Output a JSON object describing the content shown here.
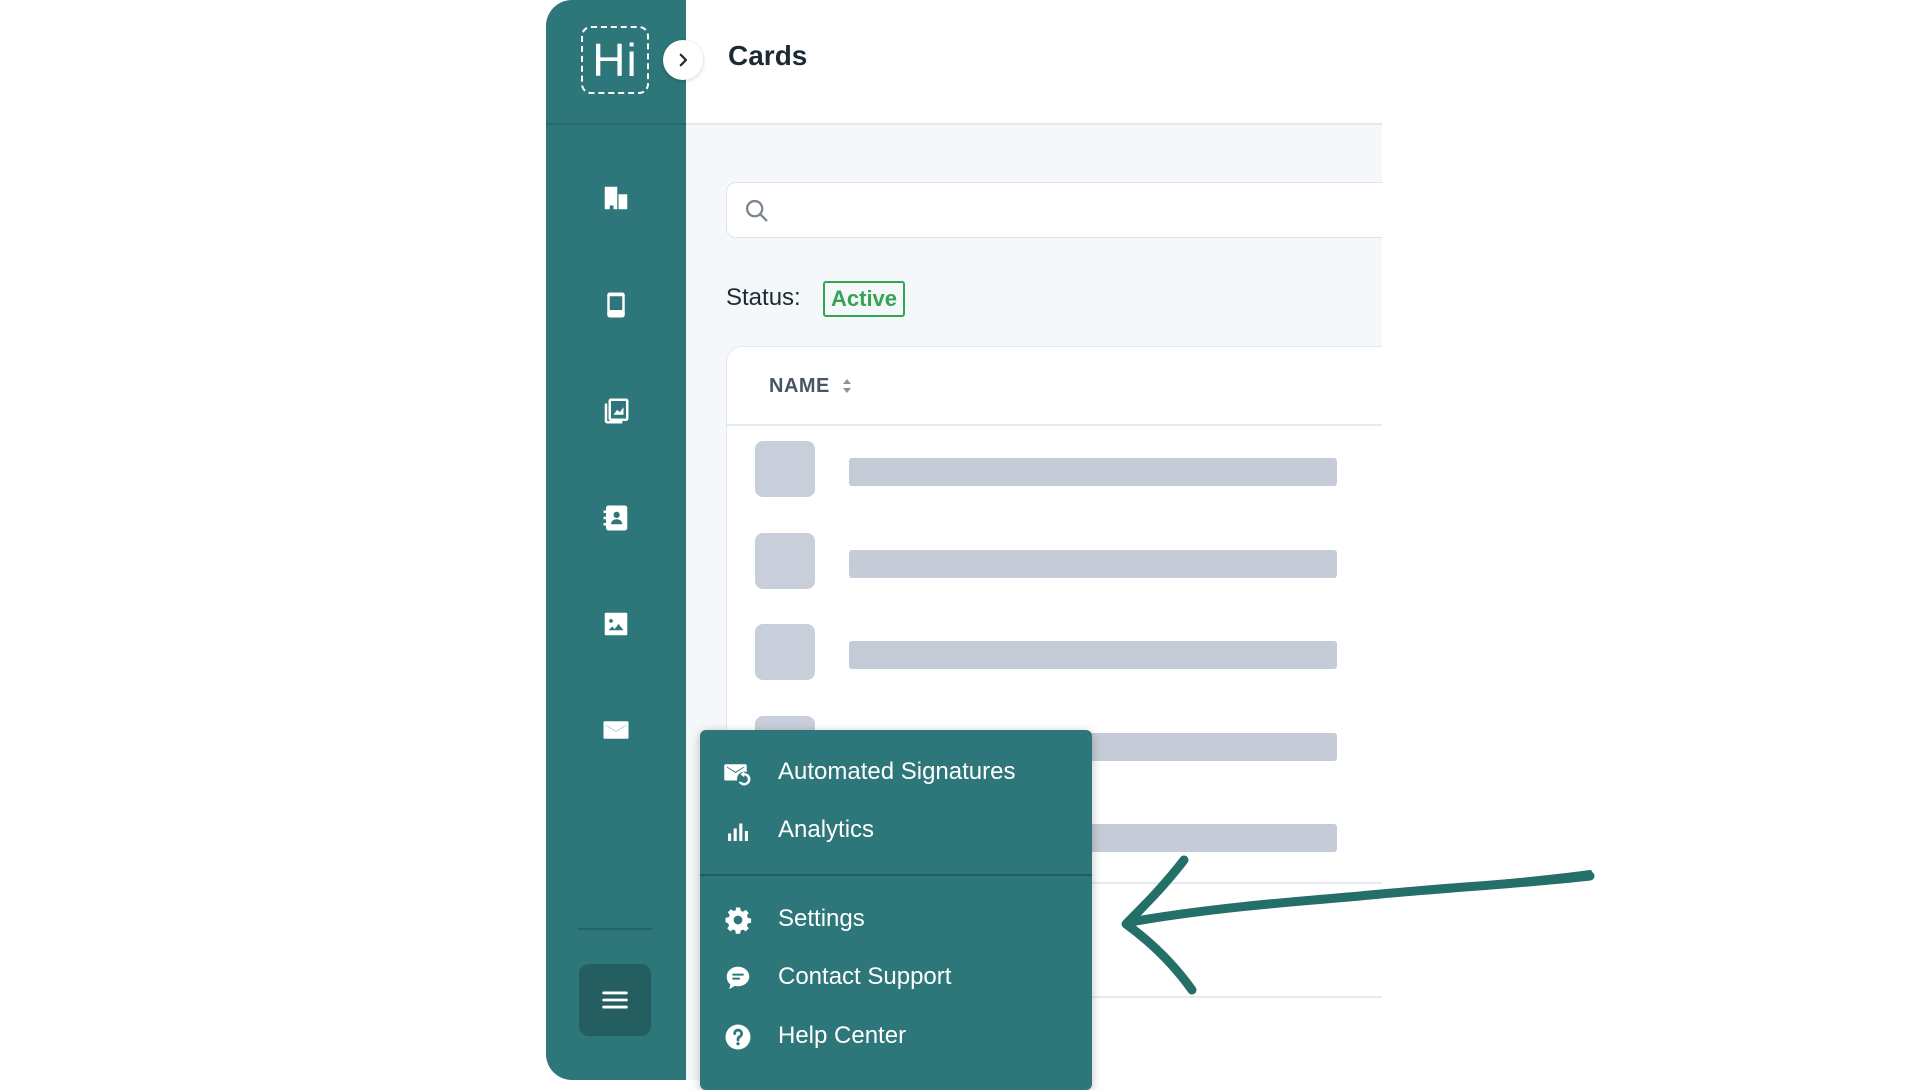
{
  "app": {
    "logo_text": "Hi",
    "page_title": "Cards"
  },
  "sidebar": {
    "items": [
      {
        "name": "company",
        "icon": "building-icon"
      },
      {
        "name": "cards",
        "icon": "phone-card-icon"
      },
      {
        "name": "templates",
        "icon": "card-stack-icon"
      },
      {
        "name": "contacts",
        "icon": "contact-book-icon"
      },
      {
        "name": "backgrounds",
        "icon": "image-icon"
      },
      {
        "name": "email-signatures",
        "icon": "envelope-icon"
      }
    ],
    "menu_icon": "hamburger-icon",
    "expand_icon": "chevron-right-icon"
  },
  "search": {
    "placeholder": "",
    "value": ""
  },
  "filter": {
    "status_label": "Status:",
    "status_value": "Active",
    "status_color": "#34a453"
  },
  "table": {
    "columns": [
      "NAME"
    ]
  },
  "dropdown": {
    "items": [
      {
        "label": "Automated Signatures",
        "icon": "mail-sync-icon"
      },
      {
        "label": "Analytics",
        "icon": "bar-chart-icon"
      },
      {
        "label": "Settings",
        "icon": "gear-icon"
      },
      {
        "label": "Contact Support",
        "icon": "chat-bubble-icon"
      },
      {
        "label": "Help Center",
        "icon": "question-circle-icon"
      }
    ]
  },
  "colors": {
    "sidebar": "#2d7679",
    "accent": "#34a453",
    "placeholder": "#c5ccd8",
    "arrow": "#246f68"
  }
}
